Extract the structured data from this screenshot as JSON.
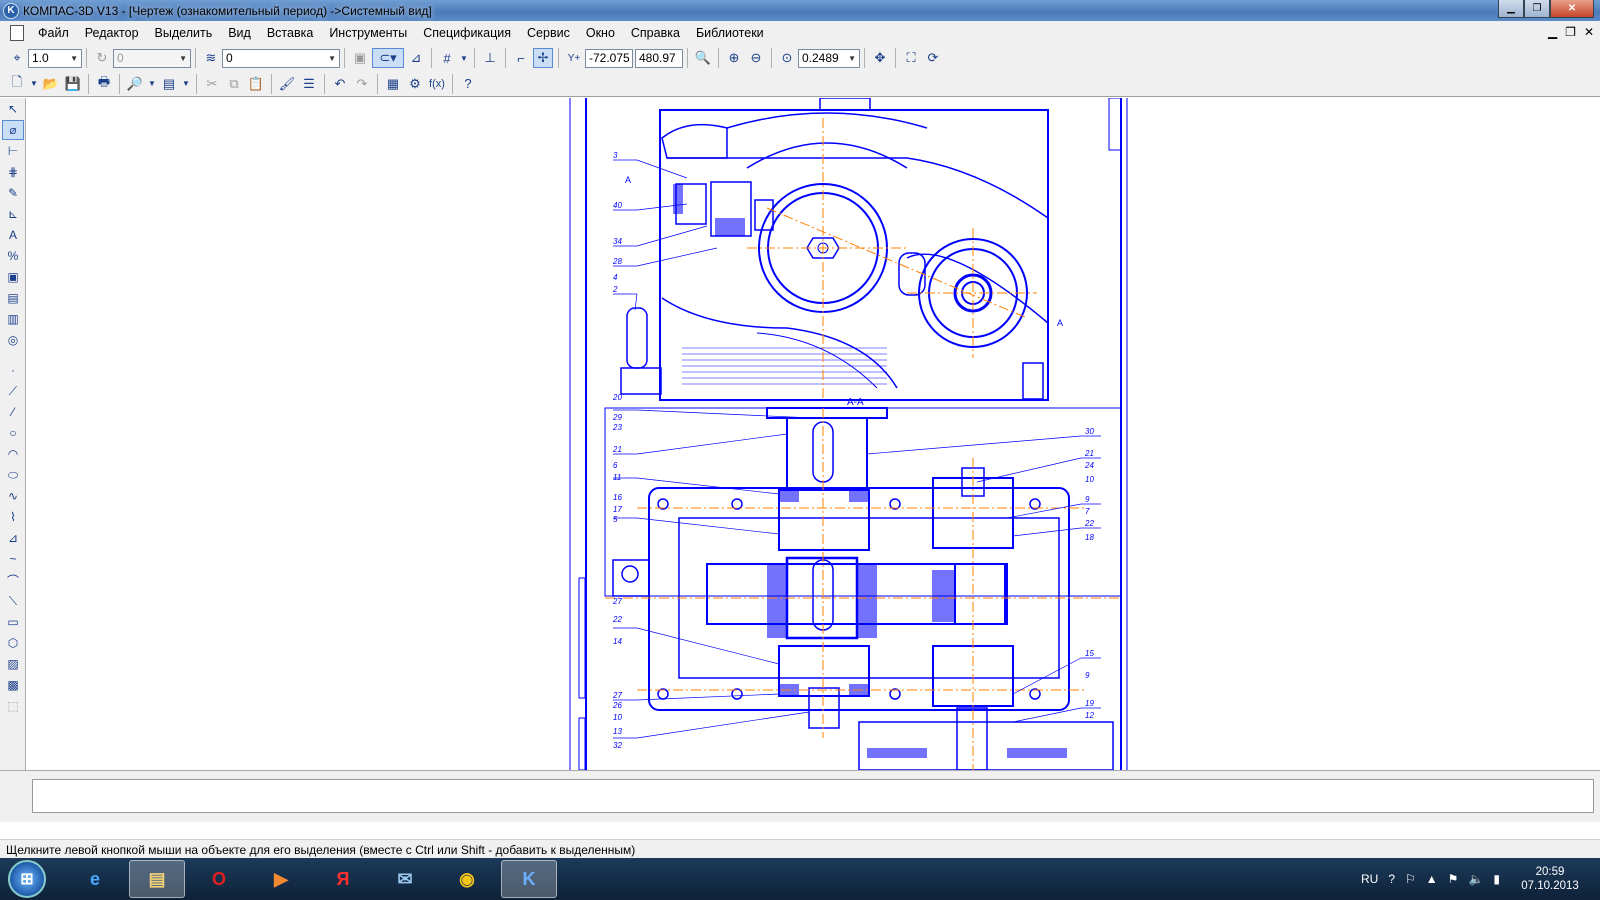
{
  "window": {
    "title": "КОМПАС-3D V13 - [Чертеж (ознакомительный период) ->Системный вид]"
  },
  "menu": [
    "Файл",
    "Редактор",
    "Выделить",
    "Вид",
    "Вставка",
    "Инструменты",
    "Спецификация",
    "Сервис",
    "Окно",
    "Справка",
    "Библиотеки"
  ],
  "toolbar": {
    "scale_value": "1.0",
    "style_value": "0",
    "layer_value": "0",
    "coord_x": "-72.075",
    "coord_y": "480.97",
    "zoom_value": "0.2489"
  },
  "drawing": {
    "section_label": "А-А",
    "marker_a": "А",
    "top_callouts": [
      "3",
      "40",
      "34",
      "28",
      "4",
      "2",
      "20"
    ],
    "left_callouts": [
      "29",
      "23",
      "21",
      "6",
      "11",
      "16",
      "17",
      "5",
      "27",
      "22",
      "14",
      "27",
      "26",
      "10",
      "13",
      "32"
    ],
    "right_callouts": [
      "30",
      "21",
      "24",
      "10",
      "9",
      "7",
      "22",
      "18",
      "15",
      "9",
      "19",
      "12"
    ]
  },
  "status_text": "Щелкните левой кнопкой мыши на объекте для его выделения (вместе с Ctrl или Shift - добавить к выделенным)",
  "taskbar": {
    "apps": [
      "ie",
      "explorer",
      "opera",
      "media",
      "yandex",
      "mail",
      "chrome",
      "kompas"
    ],
    "lang": "RU",
    "time": "20:59",
    "date": "07.10.2013"
  },
  "colors": {
    "drawing_line": "#0000ff",
    "axis_line": "#ff8000",
    "title_bar": "#4a7ab8"
  }
}
